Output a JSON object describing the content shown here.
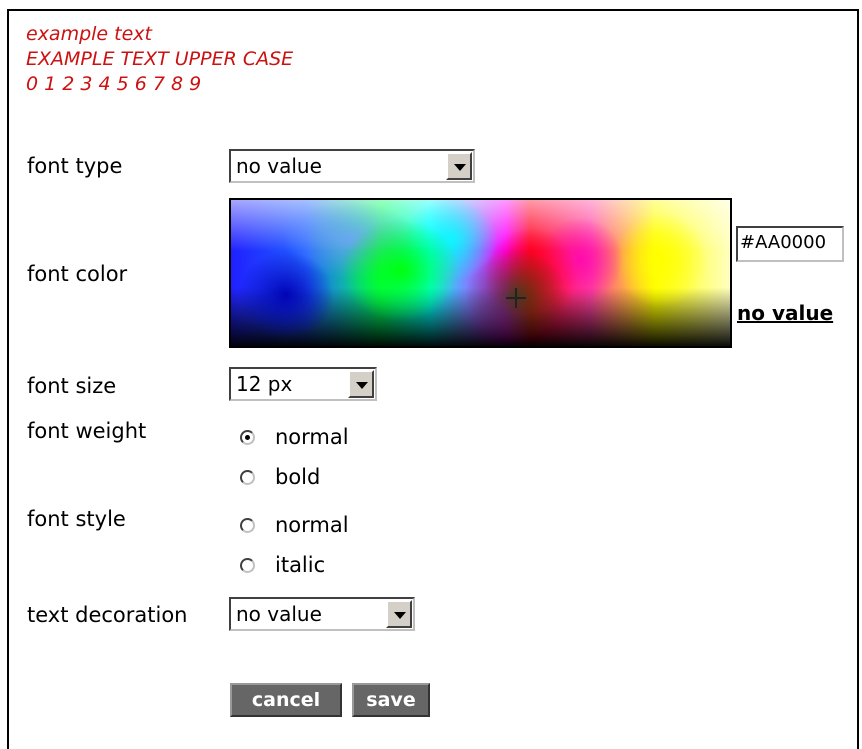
{
  "preview": {
    "line1": "example text",
    "line2": "EXAMPLE TEXT UPPER CASE",
    "line3": "0 1 2 3 4 5 6 7 8 9",
    "color": "#AA0000"
  },
  "font_type": {
    "label": "font type",
    "value": "no value"
  },
  "font_color": {
    "label": "font color",
    "hex_value": "#AA0000",
    "no_value_link": "no value"
  },
  "font_size": {
    "label": "font size",
    "value": "12 px"
  },
  "font_weight": {
    "label": "font weight",
    "options": [
      {
        "label": "normal",
        "checked": true
      },
      {
        "label": "bold",
        "checked": false
      }
    ]
  },
  "font_style": {
    "label": "font style",
    "options": [
      {
        "label": "normal",
        "checked": false
      },
      {
        "label": "italic",
        "checked": false
      }
    ]
  },
  "text_decoration": {
    "label": "text decoration",
    "value": "no value"
  },
  "buttons": {
    "cancel": "cancel",
    "save": "save"
  }
}
